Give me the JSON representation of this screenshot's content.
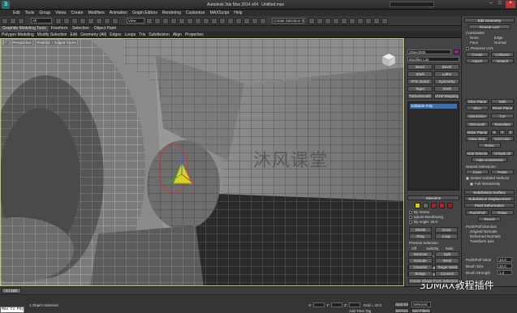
{
  "title": {
    "app": "Autodesk 3ds Max 2014 x64",
    "file": "Untitled.max"
  },
  "menubar": [
    "Edit",
    "Tools",
    "Group",
    "Views",
    "Create",
    "Modifiers",
    "Animation",
    "Graph Editors",
    "Rendering",
    "Customize",
    "MAXScript",
    "Help"
  ],
  "toolbar": {
    "filter": "All",
    "view": "View",
    "selection_set": "Create Selection Se"
  },
  "ribbon": {
    "tabs": [
      "Graphite Modeling Tools",
      "Freeform",
      "Selection",
      "Object Paint"
    ],
    "subtabs": [
      "Polygon Modeling",
      "Modify Selection",
      "Edit",
      "Geometry (All)",
      "Edges",
      "Loops",
      "Tris",
      "Subdivision",
      "Align",
      "Properties"
    ]
  },
  "viewport": {
    "label": "[ + ] [ Perspective ] [ Realistic + Edged Faces ]",
    "watermark": "沐风课堂"
  },
  "command_panel": {
    "object_name": "Object006",
    "modifier_list": "Modifier List",
    "modifiers": [
      "Bend",
      "Bevel",
      "Shell",
      "Lathe",
      "FFD 3x3x3",
      "Symmetry",
      "Taper",
      "Shell",
      "TurboSmooth",
      "UVW Mapping Clr"
    ],
    "stack_item": "Editable Poly",
    "selection": {
      "header": "Selection",
      "by_vertex": "By Vertex",
      "ignore_backfacing": "Ignore Backfacing",
      "by_angle": "By Angle: 45.0",
      "shrink": "Shrink",
      "grow": "Grow",
      "ring": "Ring",
      "loop": "Loop",
      "preview_selection": "Preview Selection",
      "off": "Off",
      "subobj": "SubObj",
      "multi": "Multi",
      "status": "144 Edges Selected"
    },
    "soft_selection": "Soft Selection",
    "edit_edges": {
      "header": "Edit Edges",
      "insert_vertex": "Insert Vertex",
      "remove": "Remove",
      "split": "Split",
      "extrude": "Extrude",
      "weld": "Weld",
      "chamfer": "Chamfer",
      "target_weld": "Target Weld",
      "bridge": "Bridge",
      "connect": "Connect",
      "create_shape": "Create Shape From Selection"
    }
  },
  "right_panel": {
    "edit_geometry": "Edit Geometry",
    "repeat_last": "Repeat Last",
    "constraints": "Constraints",
    "none": "None",
    "edge": "Edge",
    "face": "Face",
    "normal": "Normal",
    "preserve_uvs": "Preserve UVs",
    "create": "Create",
    "collapse": "Collapse",
    "attach": "Attach",
    "detach": "Detach",
    "slice_plane": "Slice Plane",
    "split": "Split",
    "slice": "Slice",
    "reset_plane": "Reset Plane",
    "quickslice": "QuickSlice",
    "cut": "Cut",
    "msmooth": "MSmooth",
    "tessellate": "Tessellate",
    "make_planar": "Make Planar",
    "x": "X",
    "y": "Y",
    "z": "Z",
    "view_align": "View Align",
    "grid_align": "Grid Align",
    "relax": "Relax",
    "hide_selected": "Hide Selected",
    "unhide_all": "Unhide All",
    "hide_unselected": "Hide Unselected",
    "named_selections": "Named Selections:",
    "copy": "Copy",
    "paste": "Paste",
    "delete_isolated": "Delete Isolated Vertices",
    "full_interactivity": "Full Interactivity",
    "subdivision_surface": "Subdivision Surface",
    "subdivision_displacement": "Subdivision Displacement",
    "paint_deformation": "Paint Deformation",
    "push_pull": "Push/Pull",
    "relax2": "Relax",
    "revert": "Revert",
    "push_pull_direction": "Push/Pull Direction",
    "original_normals": "Original Normals",
    "deformed_normals": "Deformed Normals",
    "transform_axis": "Transform axis",
    "push_pull_value": "Push/Pull Value",
    "brush_size": "Brush Size",
    "brush_strength": "Brush Strength",
    "push_pull_value_v": "10.0",
    "brush_size_v": "20.0",
    "brush_strength_v": "1.0"
  },
  "timeline": {
    "frame": "0 / 100"
  },
  "status": {
    "maxscript": "Max to Physc",
    "selected": "1 Object Selected",
    "x": "X:",
    "y": "Y:",
    "z": "Z:",
    "grid": "Grid = 10.0",
    "auto_key": "Auto Key",
    "selected_dd": "Selected",
    "set_key": "Set Key",
    "key_filters": "Key Filters...",
    "add_time_tag": "Add Time Tag"
  },
  "overlay": {
    "wechat": "3DMAX教程插件"
  }
}
